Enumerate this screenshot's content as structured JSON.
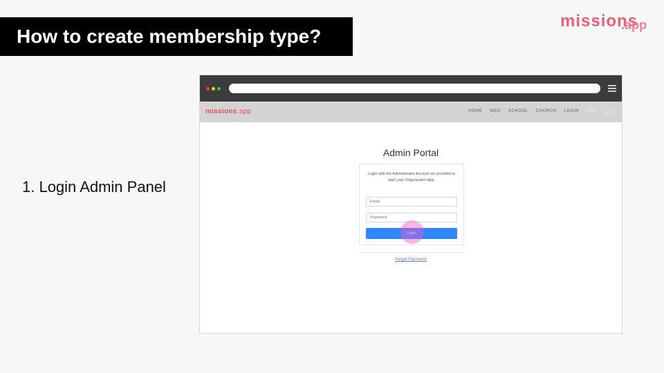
{
  "slide": {
    "title": "How to create membership type?",
    "step": "1. Login Admin Panel"
  },
  "brand": {
    "logo_text": "missions",
    "logo_suffix": ".app"
  },
  "browser": {
    "site": {
      "logo_text": "missions",
      "logo_suffix": ".app",
      "nav": [
        "HOME",
        "NGO",
        "SCHOOL",
        "CHURCH",
        "LOGIN",
        "ENG",
        "中文"
      ]
    },
    "portal": {
      "title": "Admin Portal",
      "description": "Login with the Administrator Account we provided to start your Organization App.",
      "email_placeholder": "Email",
      "password_placeholder": "Password",
      "login_label": "Login",
      "forgot_label": "Forgot Password"
    }
  },
  "colors": {
    "title_bg": "#000000",
    "login_button": "#2f86ff",
    "site_logo": "#e04e5d",
    "click_indicator": "#f05ac8"
  }
}
